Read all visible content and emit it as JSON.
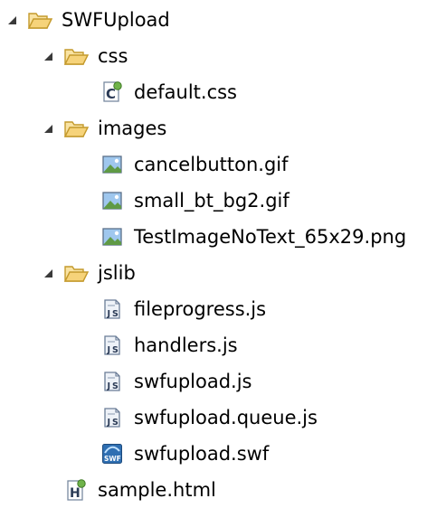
{
  "tree": {
    "root": {
      "label": "SWFUpload",
      "expanded": true,
      "icon": "folder-open-icon"
    },
    "css_folder": {
      "label": "css",
      "expanded": true,
      "icon": "folder-open-icon"
    },
    "css_default": {
      "label": "default.css",
      "icon": "css-file-icon"
    },
    "images_folder": {
      "label": "images",
      "expanded": true,
      "icon": "folder-open-icon"
    },
    "img_cancel": {
      "label": "cancelbutton.gif",
      "icon": "image-file-icon"
    },
    "img_small": {
      "label": "small_bt_bg2.gif",
      "icon": "image-file-icon"
    },
    "img_test": {
      "label": "TestImageNoText_65x29.png",
      "icon": "image-file-icon"
    },
    "jslib_folder": {
      "label": "jslib",
      "expanded": true,
      "icon": "folder-open-icon"
    },
    "js_fileprogress": {
      "label": "fileprogress.js",
      "icon": "js-file-icon"
    },
    "js_handlers": {
      "label": "handlers.js",
      "icon": "js-file-icon"
    },
    "js_swfupload": {
      "label": "swfupload.js",
      "icon": "js-file-icon"
    },
    "js_queue": {
      "label": "swfupload.queue.js",
      "icon": "js-file-icon"
    },
    "swf_file": {
      "label": "swfupload.swf",
      "icon": "swf-file-icon"
    },
    "sample_html": {
      "label": "sample.html",
      "icon": "html-file-icon"
    }
  },
  "colors": {
    "folder_fill": "#f6d37a",
    "folder_stroke": "#c49a2c",
    "twisty": "#3a3a3a",
    "image_sky": "#9fc7ee",
    "swf_blue": "#2f6fb2",
    "js_paper": "#eef2f8"
  }
}
